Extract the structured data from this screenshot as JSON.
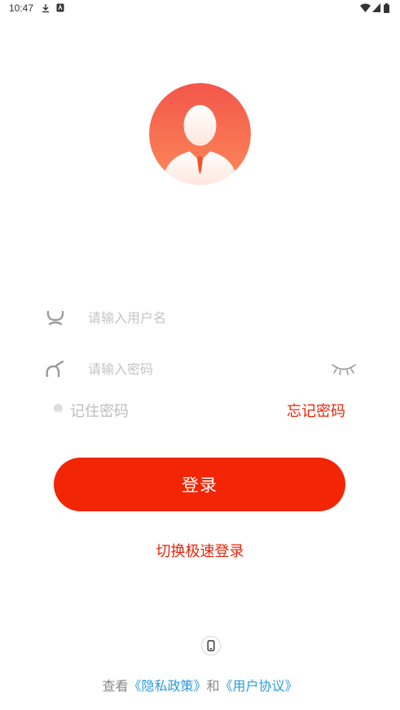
{
  "status_bar": {
    "time": "10:47"
  },
  "login_form": {
    "username_placeholder": "请输入用户名",
    "password_placeholder": "请输入密码",
    "remember_label": "记住密码",
    "forgot_label": "忘记密码",
    "login_label": "登录",
    "quick_login_label": "切换极速登录"
  },
  "agreement": {
    "prefix": "查看",
    "privacy": "《隐私政策》",
    "conj": "和",
    "user_agreement": "《用户协议》"
  },
  "colors": {
    "accent": "#f22505",
    "link": "#2e9ae0",
    "avatar_top": "#f3564a",
    "avatar_bottom": "#fc8a5a"
  }
}
